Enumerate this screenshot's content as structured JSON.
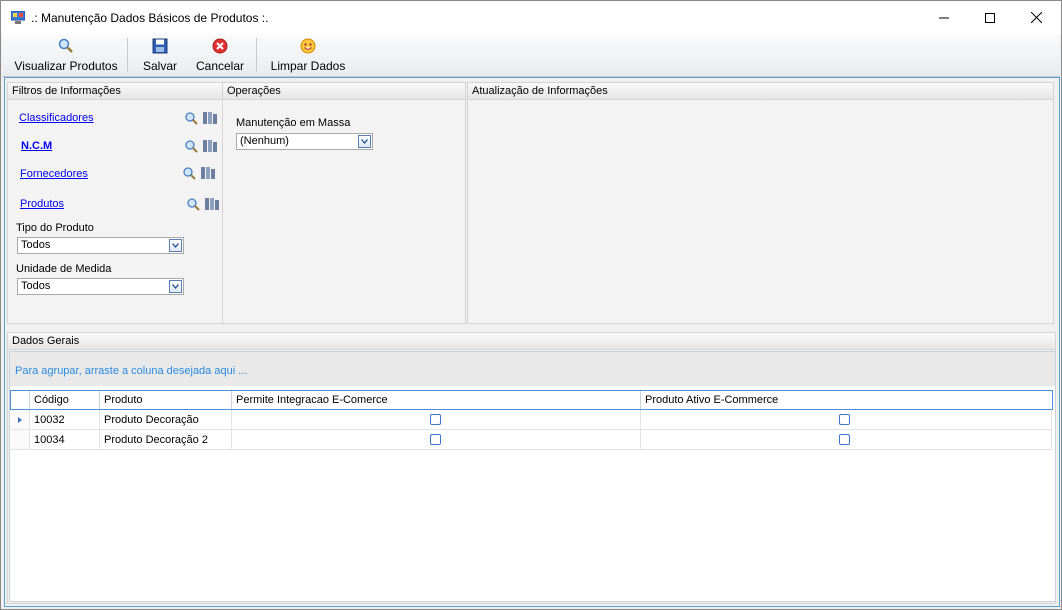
{
  "window": {
    "title": ".: Manutenção Dados Básicos de Produtos :."
  },
  "toolbar": {
    "visualizar": "Visualizar Produtos",
    "salvar": "Salvar",
    "cancelar": "Cancelar",
    "limpar": "Limpar Dados"
  },
  "filtros": {
    "title": "Filtros de Informações",
    "links": [
      "Classificadores",
      "N.C.M",
      "Fornecedores",
      "Produtos"
    ],
    "tipo_label": "Tipo do Produto",
    "tipo_value": "Todos",
    "unidade_label": "Unidade de Medida",
    "unidade_value": "Todos"
  },
  "operacoes": {
    "title": "Operações",
    "label": "Manutenção em Massa",
    "value": "(Nenhum)"
  },
  "atualizacao": {
    "title": "Atualização de Informações"
  },
  "dados": {
    "title": "Dados Gerais",
    "group_hint": "Para agrupar, arraste a coluna desejada aqui ...",
    "columns": [
      "Código",
      "Produto",
      "Permite Integracao E-Comerce",
      "Produto Ativo E-Commerce"
    ],
    "rows": [
      {
        "codigo": "10032",
        "produto": "Produto Decoração",
        "permite": false,
        "ativo": false
      },
      {
        "codigo": "10034",
        "produto": "Produto Decoração 2",
        "permite": false,
        "ativo": false
      }
    ]
  }
}
